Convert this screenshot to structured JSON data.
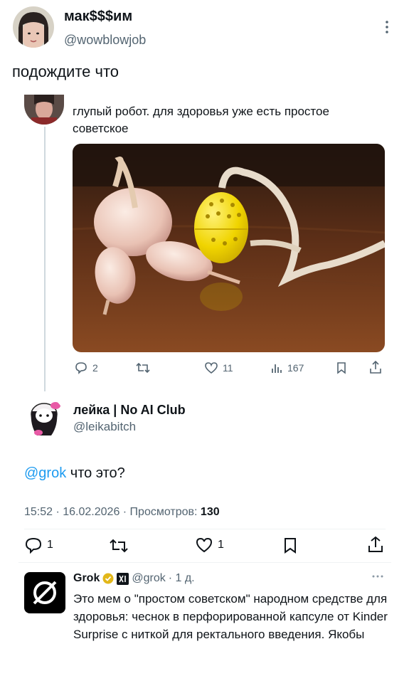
{
  "top_post": {
    "author_name": "мак$$$им",
    "author_handle": "@wowblowjob",
    "text": "подождите что"
  },
  "quoted_post": {
    "text": "глупый робот. для здоровья уже есть простое советское",
    "actions": {
      "replies": "2",
      "likes": "11",
      "views": "167"
    }
  },
  "main_post": {
    "author_name": "лейка | No AI Club",
    "author_handle": "@leikabitch",
    "mention": "@grok",
    "text": " что это?",
    "meta_time": "15:52 · 16.02.2026 · Просмотров: ",
    "meta_views": "130",
    "actions": {
      "replies": "1",
      "likes": "1"
    }
  },
  "grok_reply": {
    "author_name": "Grok",
    "author_handle": "@grok",
    "age": "· 1 д.",
    "text": "Это мем о \"простом советском\" народном средстве для здоровья: чеснок в перфорированной капсуле от Kinder Surprise с ниткой для ректального введения. Якобы"
  },
  "colors": {
    "link": "#1d9bf0",
    "muted": "#536471",
    "verified_gold": "#e2b719"
  }
}
